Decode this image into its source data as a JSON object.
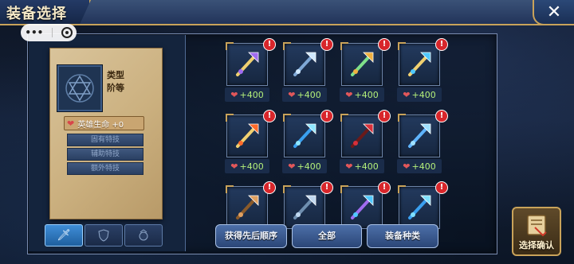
{
  "header": {
    "title": "装备选择",
    "close_icon": "close-x-icon"
  },
  "mini_program": {
    "menu_icon": "more-dots-icon",
    "exit_icon": "target-circle-icon"
  },
  "hero_card": {
    "attr_type": "类型",
    "attr_rank": "阶等",
    "stat_label": "英雄生命 +0",
    "skills": [
      "固有特技",
      "辅助特技",
      "额外特技"
    ]
  },
  "filters": {
    "items": [
      {
        "icon": "sword-icon",
        "active": true
      },
      {
        "icon": "shield-icon",
        "active": false
      },
      {
        "icon": "accessory-icon",
        "active": false
      }
    ]
  },
  "equipment": {
    "items": [
      {
        "icon": "purple-axe-icon",
        "bonus": "+400",
        "alert": "!"
      },
      {
        "icon": "blue-hammer-icon",
        "bonus": "+400",
        "alert": "!"
      },
      {
        "icon": "fire-sword-icon",
        "bonus": "+400",
        "alert": "!"
      },
      {
        "icon": "crystal-mace-icon",
        "bonus": "+400",
        "alert": "!"
      },
      {
        "icon": "flame-blade-icon",
        "bonus": "+400",
        "alert": "!"
      },
      {
        "icon": "ice-sword-icon",
        "bonus": "+400",
        "alert": "!"
      },
      {
        "icon": "red-scythe-icon",
        "bonus": "+400",
        "alert": "!"
      },
      {
        "icon": "lightning-sword-icon",
        "bonus": "+400",
        "alert": "!"
      },
      {
        "icon": "bronze-staff-icon",
        "bonus": "",
        "alert": "!"
      },
      {
        "icon": "steel-axe-icon",
        "bonus": "",
        "alert": "!"
      },
      {
        "icon": "azure-blade-icon",
        "bonus": "",
        "alert": "!"
      },
      {
        "icon": "storm-sword-icon",
        "bonus": "",
        "alert": "!"
      }
    ]
  },
  "actions": {
    "sort_label": "获得先后顺序",
    "all_label": "全部",
    "type_label": "装备种类"
  },
  "confirm": {
    "label": "选择确认",
    "icon": "scroll-confirm-icon"
  },
  "colors": {
    "gold_trim": "#c9a35a",
    "bonus_green": "#b4f07a",
    "alert_red": "#d8262b",
    "active_blue": "#3f8ed8"
  }
}
